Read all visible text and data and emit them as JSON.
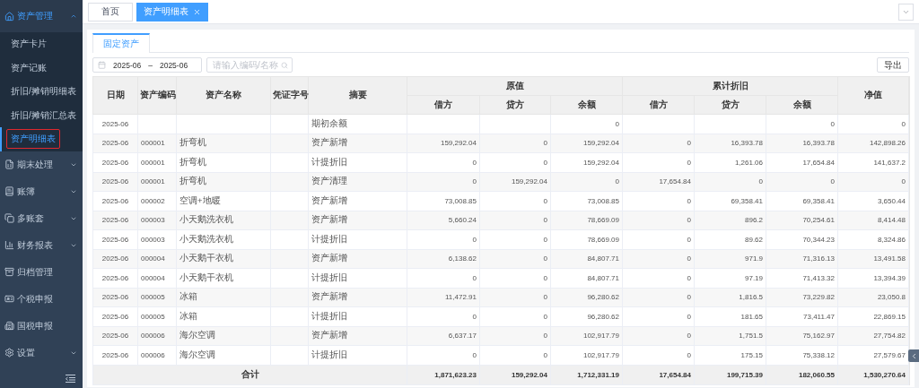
{
  "sidebar": {
    "groups": [
      {
        "label": "资产管理",
        "kind": "menu",
        "expanded": true,
        "selected": true,
        "children": [
          {
            "label": "资产卡片",
            "selected": false,
            "highlighted": false
          },
          {
            "label": "资产记账",
            "selected": false,
            "highlighted": false
          },
          {
            "label": "折旧/摊销明细表",
            "selected": false,
            "highlighted": false
          },
          {
            "label": "折旧/摊销汇总表",
            "selected": false,
            "highlighted": false
          },
          {
            "label": "资产明细表",
            "selected": true,
            "highlighted": true
          }
        ]
      },
      {
        "label": "期末处理",
        "kind": "menu",
        "expanded": false,
        "selected": false
      },
      {
        "label": "账簿",
        "kind": "menu",
        "expanded": false,
        "selected": false
      },
      {
        "label": "多账套",
        "kind": "menu",
        "expanded": false,
        "selected": false
      },
      {
        "label": "财务报表",
        "kind": "menu",
        "expanded": false,
        "selected": false
      },
      {
        "label": "归档管理",
        "kind": "link",
        "selected": false
      },
      {
        "label": "个税申报",
        "kind": "link",
        "selected": false
      },
      {
        "label": "国税申报",
        "kind": "link",
        "selected": false
      },
      {
        "label": "设置",
        "kind": "menu",
        "expanded": false,
        "selected": false
      }
    ]
  },
  "tabs": [
    {
      "label": "首页",
      "selected": false,
      "closable": false
    },
    {
      "label": "资产明细表",
      "selected": true,
      "closable": true
    }
  ],
  "sub_tabs": [
    {
      "label": "固定资产",
      "selected": true
    }
  ],
  "filters": {
    "start": "2025-06",
    "separator": "–",
    "end": "2025-06",
    "search": {
      "placeholder": "请输入编码/名称"
    }
  },
  "export_button": "导出",
  "table": {
    "column_groups": [
      {
        "label": "原值"
      },
      {
        "label": "累计折旧"
      }
    ],
    "columns": [
      {
        "label": "日期"
      },
      {
        "label": "资产编码"
      },
      {
        "label": "资产名称"
      },
      {
        "label": "凭证字号"
      },
      {
        "label": "摘要"
      },
      {
        "label": "借方"
      },
      {
        "label": "贷方"
      },
      {
        "label": "余额"
      },
      {
        "label": "借方"
      },
      {
        "label": "贷方"
      },
      {
        "label": "余额"
      },
      {
        "label": "净值"
      }
    ],
    "rows": [
      [
        "2025-06",
        "",
        "",
        "",
        "期初余额",
        "",
        "",
        "0",
        "",
        "",
        "0",
        "0"
      ],
      [
        "2025-06",
        "000001",
        "折弯机",
        "",
        "资产新增",
        "159,292.04",
        "0",
        "159,292.04",
        "0",
        "16,393.78",
        "16,393.78",
        "142,898.26"
      ],
      [
        "2025-06",
        "000001",
        "折弯机",
        "",
        "计提折旧",
        "0",
        "0",
        "159,292.04",
        "0",
        "1,261.06",
        "17,654.84",
        "141,637.2"
      ],
      [
        "2025-06",
        "000001",
        "折弯机",
        "",
        "资产清理",
        "0",
        "159,292.04",
        "0",
        "17,654.84",
        "0",
        "0",
        "0"
      ],
      [
        "2025-06",
        "000002",
        "空调+地暖",
        "",
        "资产新增",
        "73,008.85",
        "0",
        "73,008.85",
        "0",
        "69,358.41",
        "69,358.41",
        "3,650.44"
      ],
      [
        "2025-06",
        "000003",
        "小天鹅洗衣机",
        "",
        "资产新增",
        "5,660.24",
        "0",
        "78,669.09",
        "0",
        "896.2",
        "70,254.61",
        "8,414.48"
      ],
      [
        "2025-06",
        "000003",
        "小天鹅洗衣机",
        "",
        "计提折旧",
        "0",
        "0",
        "78,669.09",
        "0",
        "89.62",
        "70,344.23",
        "8,324.86"
      ],
      [
        "2025-06",
        "000004",
        "小天鹅干衣机",
        "",
        "资产新增",
        "6,138.62",
        "0",
        "84,807.71",
        "0",
        "971.9",
        "71,316.13",
        "13,491.58"
      ],
      [
        "2025-06",
        "000004",
        "小天鹅干衣机",
        "",
        "计提折旧",
        "0",
        "0",
        "84,807.71",
        "0",
        "97.19",
        "71,413.32",
        "13,394.39"
      ],
      [
        "2025-06",
        "000005",
        "冰箱",
        "",
        "资产新增",
        "11,472.91",
        "0",
        "96,280.62",
        "0",
        "1,816.5",
        "73,229.82",
        "23,050.8"
      ],
      [
        "2025-06",
        "000005",
        "冰箱",
        "",
        "计提折旧",
        "0",
        "0",
        "96,280.62",
        "0",
        "181.65",
        "73,411.47",
        "22,869.15"
      ],
      [
        "2025-06",
        "000006",
        "海尔空调",
        "",
        "资产新增",
        "6,637.17",
        "0",
        "102,917.79",
        "0",
        "1,751.5",
        "75,162.97",
        "27,754.82"
      ],
      [
        "2025-06",
        "000006",
        "海尔空调",
        "",
        "计提折旧",
        "0",
        "0",
        "102,917.79",
        "0",
        "175.15",
        "75,338.12",
        "27,579.67"
      ]
    ],
    "total": {
      "label": "合计",
      "values": [
        "1,871,623.23",
        "159,292.04",
        "1,712,331.19",
        "17,654.84",
        "199,715.39",
        "182,060.55",
        "1,530,270.64"
      ]
    }
  }
}
